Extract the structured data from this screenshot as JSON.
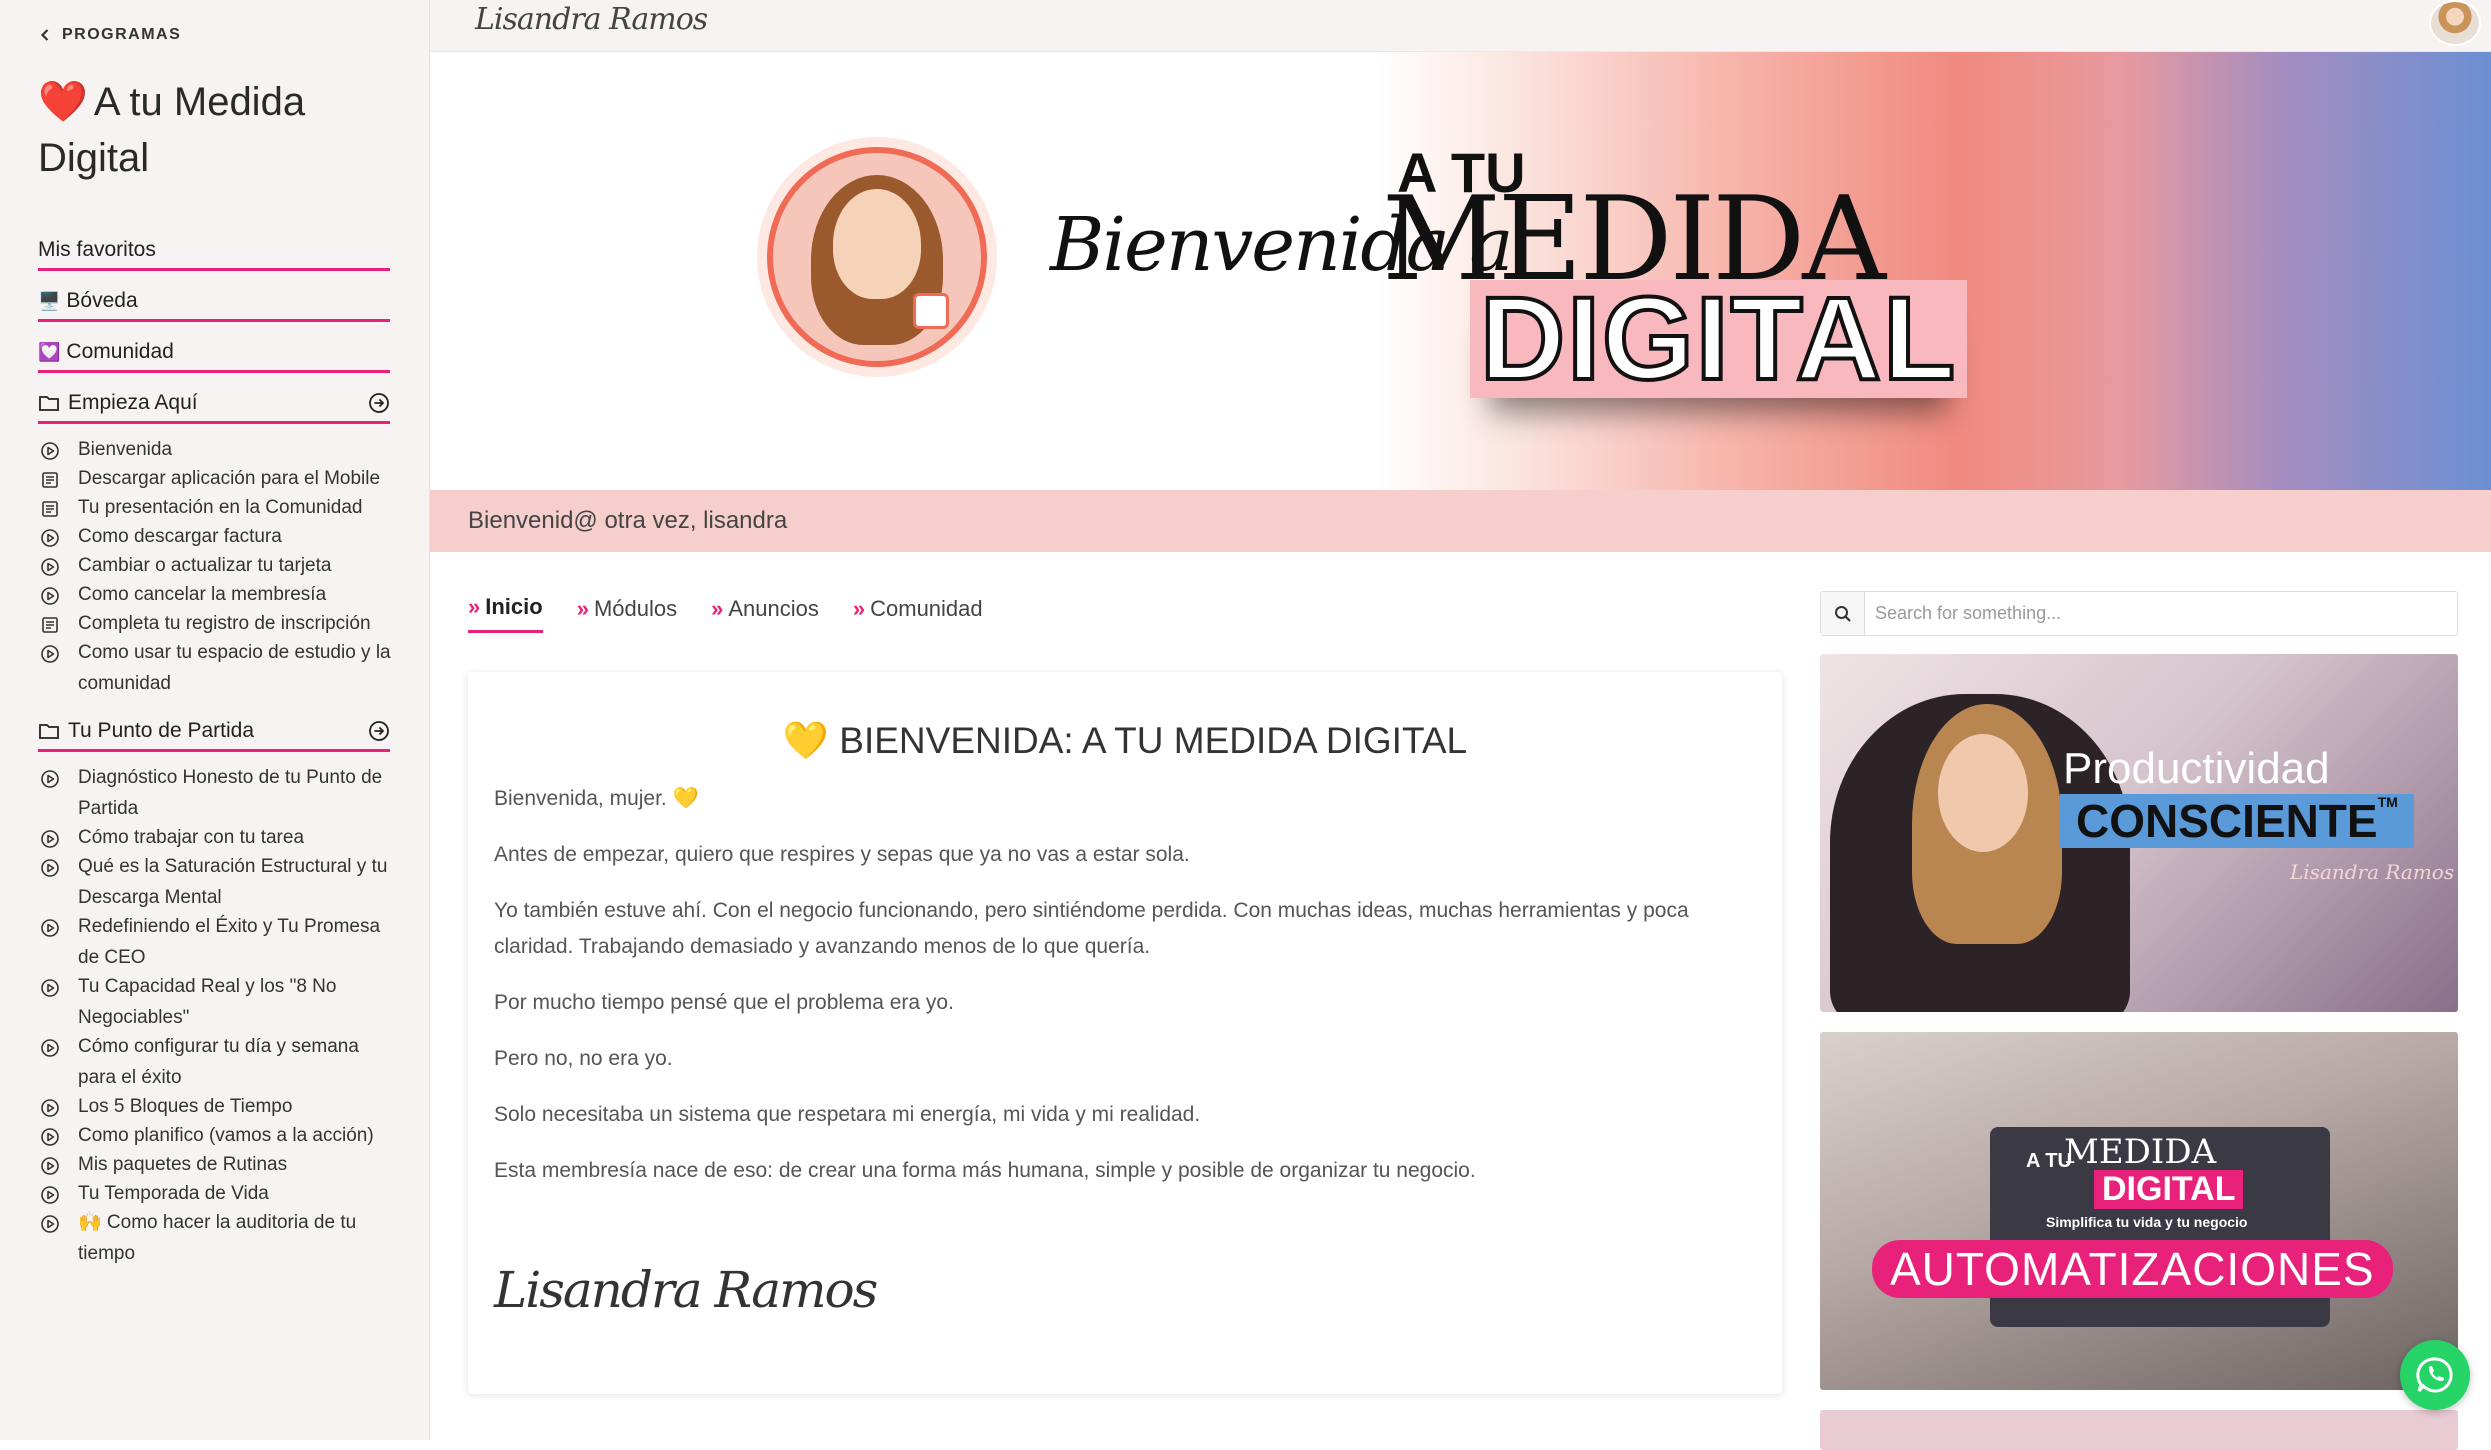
{
  "sidebar": {
    "back_label": "PROGRAMAS",
    "course_heart": "❤️",
    "course_title": "A tu Medida Digital",
    "links": [
      {
        "label": "Mis favoritos",
        "emoji": ""
      },
      {
        "label": "Bóveda",
        "emoji": "🖥️"
      },
      {
        "label": "Comunidad",
        "emoji": "💟"
      }
    ],
    "folders": [
      {
        "label": "Empieza Aquí",
        "lessons": [
          {
            "label": "Bienvenida",
            "icon": "play-circle-icon"
          },
          {
            "label": "Descargar aplicación para el Mobile",
            "icon": "document-icon"
          },
          {
            "label": "Tu presentación en la Comunidad",
            "icon": "document-icon"
          },
          {
            "label": "Como descargar factura",
            "icon": "play-circle-icon"
          },
          {
            "label": "Cambiar o actualizar tu tarjeta",
            "icon": "play-circle-icon"
          },
          {
            "label": "Como cancelar la membresía",
            "icon": "play-circle-icon"
          },
          {
            "label": "Completa tu registro de inscripción",
            "icon": "document-icon"
          },
          {
            "label": "Como usar tu espacio de estudio y la comunidad",
            "icon": "play-circle-icon"
          }
        ]
      },
      {
        "label": "Tu Punto de Partida",
        "lessons": [
          {
            "label": "Diagnóstico Honesto de tu Punto de Partida",
            "icon": "play-circle-icon"
          },
          {
            "label": "Cómo trabajar con tu tarea",
            "icon": "play-circle-icon"
          },
          {
            "label": "Qué es la Saturación Estructural y tu Descarga Mental",
            "icon": "play-circle-icon"
          },
          {
            "label": "Redefiniendo el Éxito y Tu Promesa de CEO",
            "icon": "play-circle-icon"
          },
          {
            "label": "Tu Capacidad Real y los \"8 No Negociables\"",
            "icon": "play-circle-icon"
          },
          {
            "label": "Cómo configurar tu día y semana para el éxito",
            "icon": "play-circle-icon"
          },
          {
            "label": "Los 5 Bloques de Tiempo",
            "icon": "play-circle-icon"
          },
          {
            "label": "Como planifico (vamos a la acción)",
            "icon": "play-circle-icon"
          },
          {
            "label": "Mis paquetes de Rutinas",
            "icon": "play-circle-icon"
          },
          {
            "label": "Tu Temporada de Vida",
            "icon": "play-circle-icon"
          },
          {
            "label": "🙌 Como hacer la auditoria de tu tiempo",
            "icon": "play-circle-icon"
          }
        ]
      }
    ]
  },
  "topbar": {
    "logo_text": "Lisandra Ramos"
  },
  "hero": {
    "script_text": "Bienvenida a",
    "atu_text": "A TU",
    "medida_text": "MEDIDA",
    "digital_text": "DIGITAL"
  },
  "welcome_text": "Bienvenid@ otra vez, lisandra",
  "tabs": [
    {
      "label": "Inicio",
      "active": true
    },
    {
      "label": "Módulos",
      "active": false
    },
    {
      "label": "Anuncios",
      "active": false
    },
    {
      "label": "Comunidad",
      "active": false
    }
  ],
  "post": {
    "title_emoji": "💛",
    "title": "BIENVENIDA: A TU MEDIDA DIGITAL",
    "paragraphs": [
      "Bienvenida, mujer. 💛",
      "Antes de empezar, quiero que respires y sepas que ya no vas a estar sola.",
      "Yo también estuve ahí. Con el negocio funcionando, pero sintiéndome perdida. Con muchas ideas, muchas herramientas y poca claridad. Trabajando demasiado y avanzando menos de lo que quería.",
      "Por mucho tiempo pensé que el problema era yo.",
      "Pero no, no era yo.",
      "Solo necesitaba un sistema que respetara mi energía, mi vida y mi realidad.",
      "Esta membresía nace de eso: de crear una forma más humana, simple y posible de organizar tu negocio."
    ],
    "signature": "Lisandra Ramos"
  },
  "search": {
    "placeholder": "Search for something..."
  },
  "promos": {
    "p1_line1": "Productividad",
    "p1_line2": "CONSCIENTE",
    "p1_tm": "TM",
    "p1_logo": "Lisandra Ramos",
    "p2_atu": "A TU",
    "p2_medida": "MEDIDA",
    "p2_digital": "DIGITAL",
    "p2_tagline": "Simplifica tu vida y tu negocio",
    "p2_pill": "AUTOMATIZACIONES"
  },
  "colors": {
    "accent": "#e8227a",
    "welcome_bg": "#f6cfcd",
    "sidebar_bg": "#f7f3f2",
    "whatsapp": "#25d366"
  }
}
